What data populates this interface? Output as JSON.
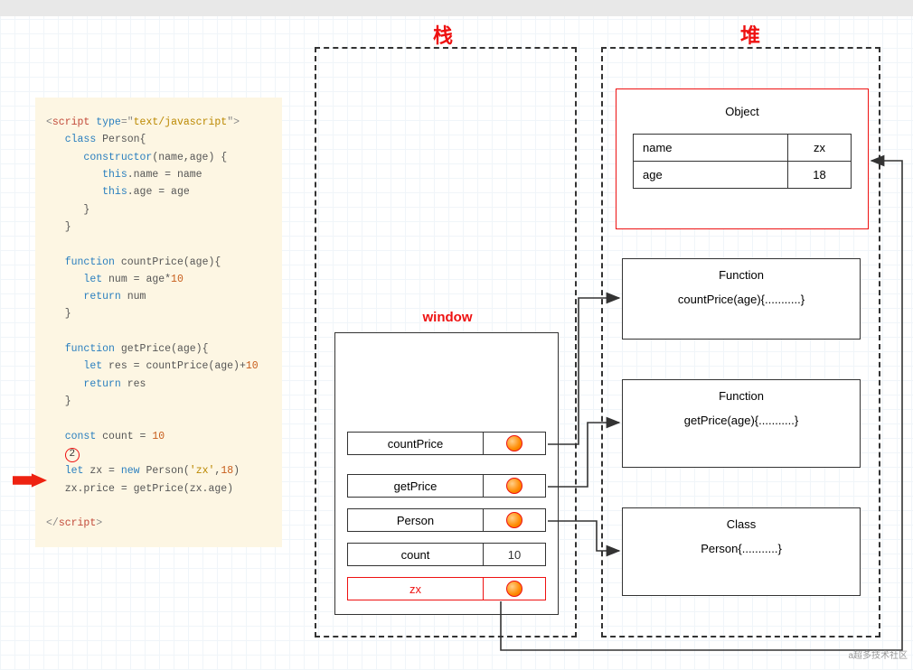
{
  "titles": {
    "stack": "栈",
    "heap": "堆",
    "window": "window"
  },
  "code": {
    "openTag": {
      "lt": "<",
      "tag": "script",
      "attr": " type",
      "eq1": "=",
      "q1": "\"",
      "val": "text/javascript",
      "q2": "\"",
      "gt": ">"
    },
    "line_class": {
      "kw": "class",
      "name": " Person",
      "rest": "{"
    },
    "line_ctor": {
      "kw": "constructor",
      "rest": "(name,age) {"
    },
    "line_thisname": {
      "kw": "this",
      "rest": ".name = name"
    },
    "line_thisage": {
      "kw": "this",
      "rest": ".age = age"
    },
    "brace": "}",
    "line_fn1": {
      "kw": "function",
      "name": " countPrice",
      "rest": "(age){"
    },
    "line_letnum": {
      "kw": "let ",
      "rest": "num = age*",
      "num": "10"
    },
    "line_retnum": {
      "kw": "return ",
      "rest": "num"
    },
    "line_fn2": {
      "kw": "function",
      "name": " getPrice",
      "rest": "(age){"
    },
    "line_letres": {
      "kw": "let ",
      "rest": "res = countPrice(age)+",
      "num": "10"
    },
    "line_retres": {
      "kw": "return ",
      "rest": "res"
    },
    "line_const": {
      "kw": "const ",
      "name": "count = ",
      "num": "10"
    },
    "badge2": "2",
    "line_letzx": {
      "kw": "let ",
      "rest1": "zx = ",
      "kw2": "new",
      "rest2": " Person(",
      "q": "'",
      "str": "zx",
      "q2": "'",
      "comma": ",",
      "num": "18",
      "close": ")"
    },
    "line_price": "zx.price = getPrice(zx.age)",
    "closeTag": {
      "lt": "</",
      "tag": "script",
      "gt": ">"
    }
  },
  "window_slots": [
    {
      "label": "countPrice",
      "value": "●"
    },
    {
      "label": "getPrice",
      "value": "●"
    },
    {
      "label": "Person",
      "value": "●"
    },
    {
      "label": "count",
      "value": "10"
    },
    {
      "label": "zx",
      "value": "●",
      "red": true
    }
  ],
  "heap_object": {
    "title": "Object",
    "rows": [
      {
        "k": "name",
        "v": "zx"
      },
      {
        "k": "age",
        "v": "18"
      }
    ]
  },
  "heap_boxes": [
    {
      "title": "Function",
      "body": "countPrice(age){...........}"
    },
    {
      "title": "Function",
      "body": "getPrice(age){...........}"
    },
    {
      "title": "Class",
      "body": "Person{...........}"
    }
  ],
  "watermark": "a超多技术社区"
}
